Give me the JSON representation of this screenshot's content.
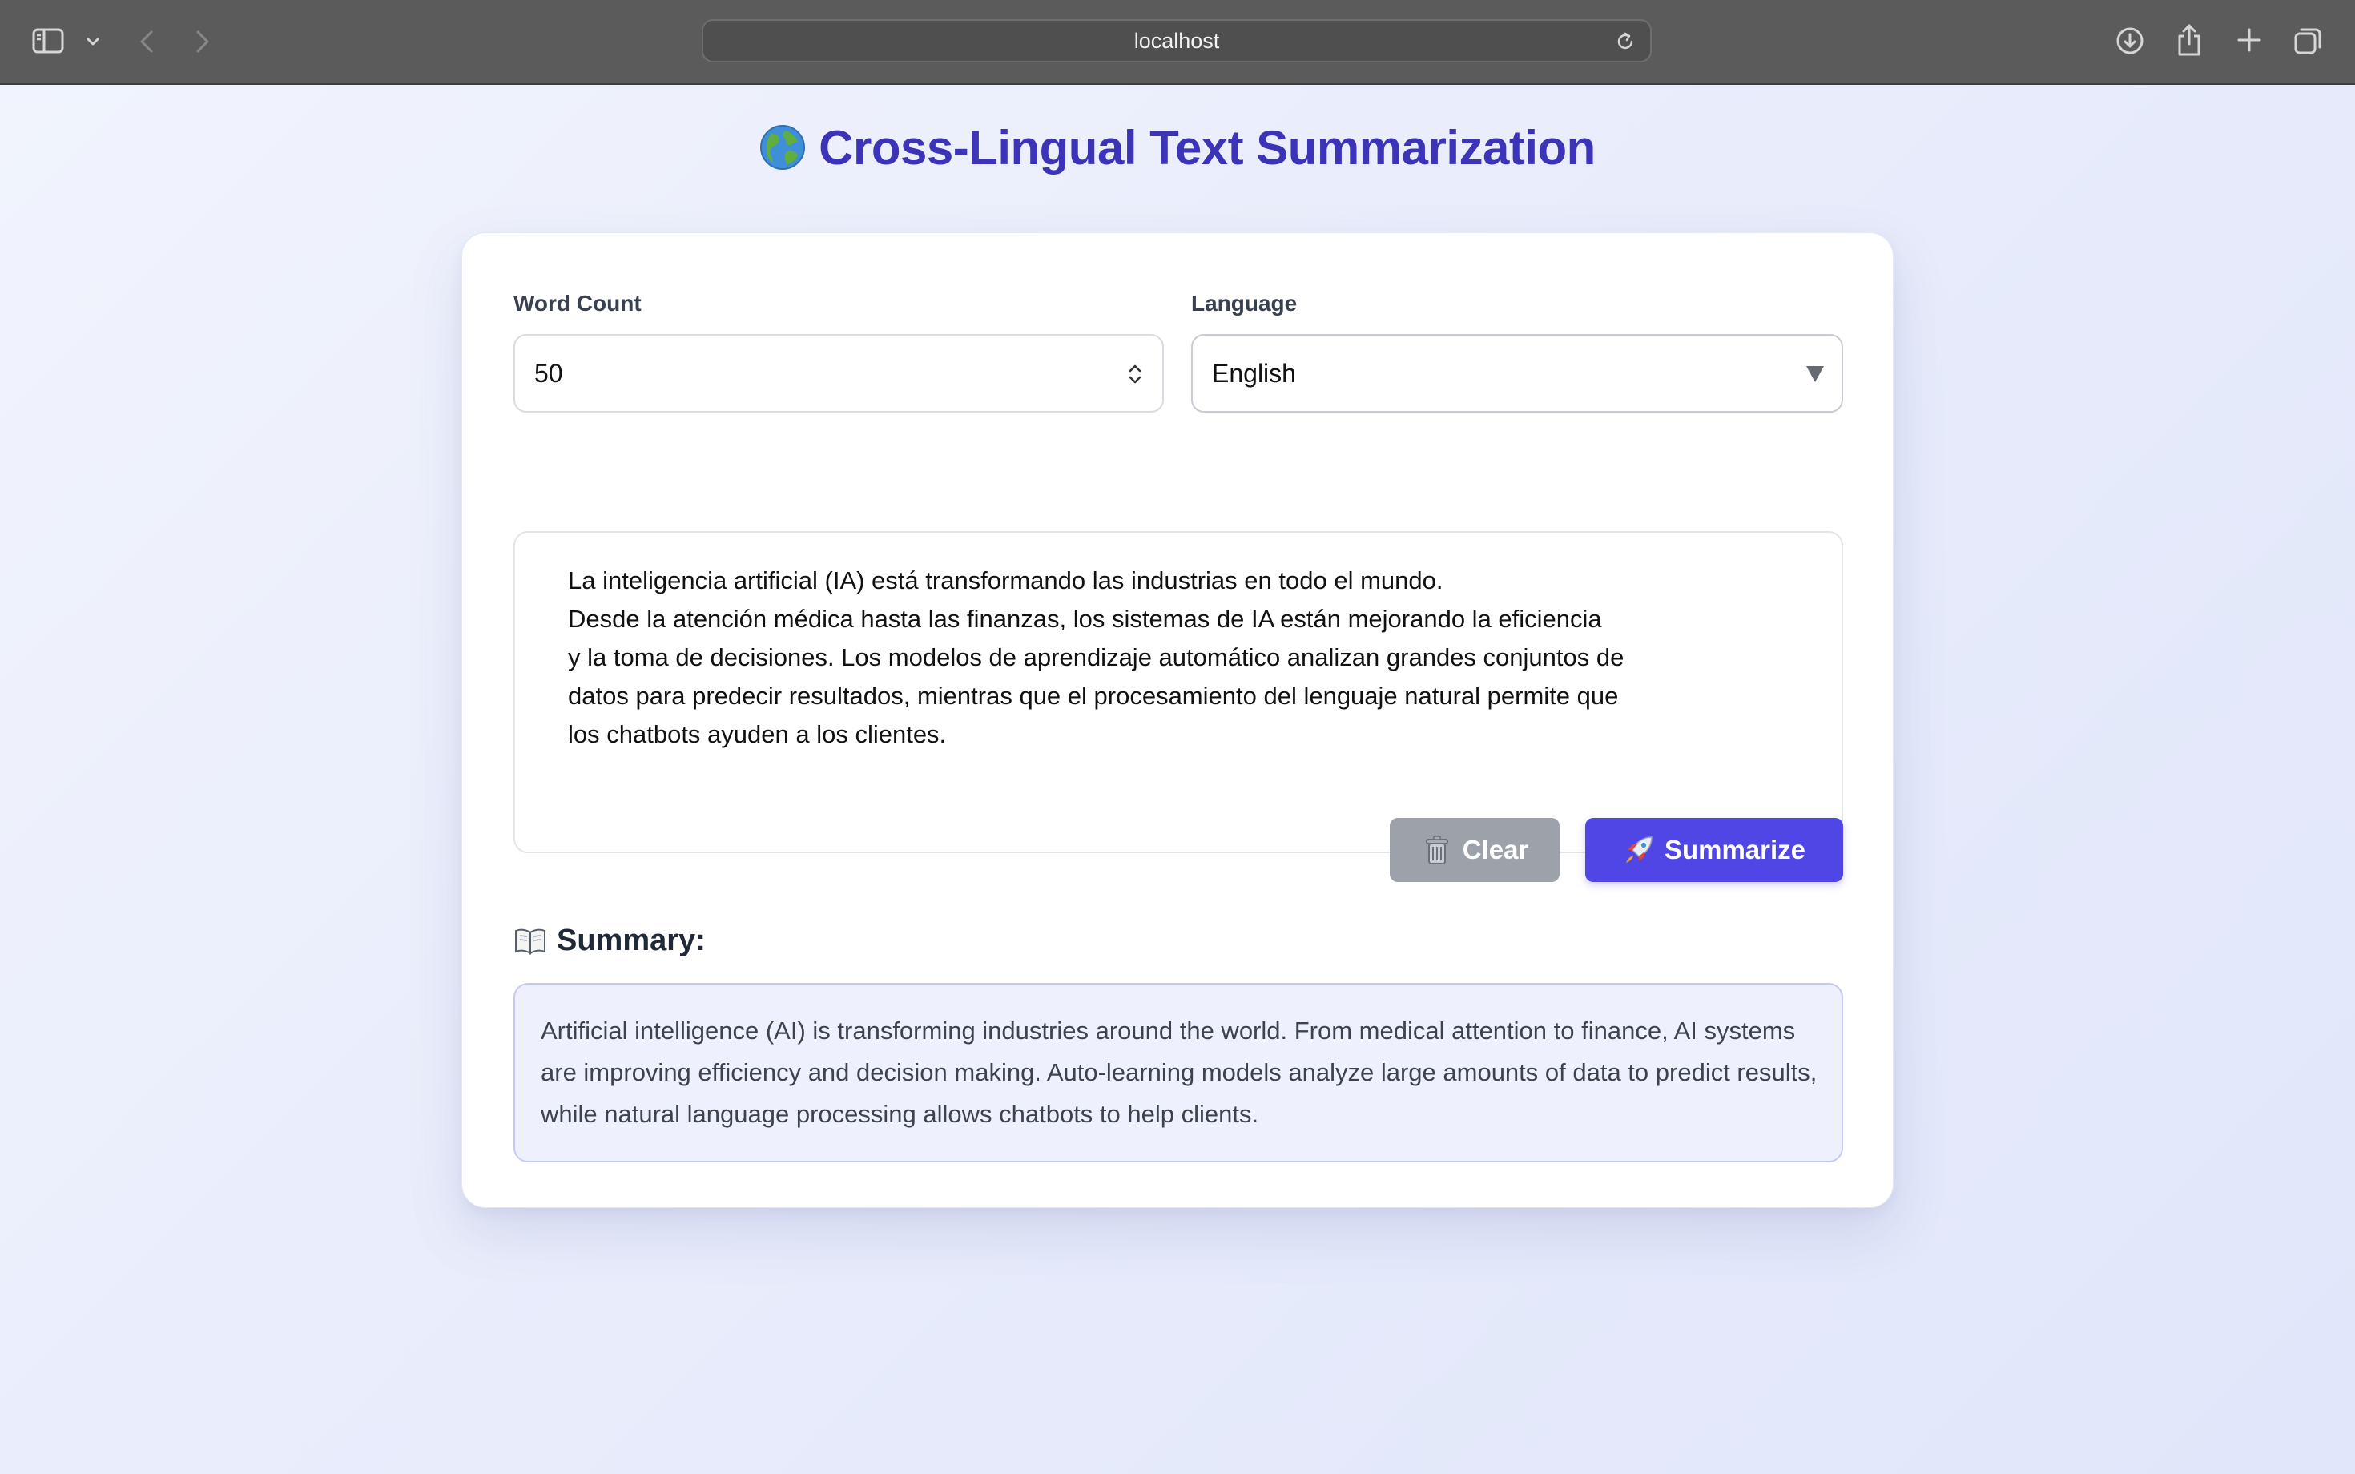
{
  "browser": {
    "url": "localhost"
  },
  "page": {
    "title": "Cross-Lingual Text Summarization",
    "title_icon": "globe-icon"
  },
  "form": {
    "word_count_label": "Word Count",
    "word_count_value": "50",
    "language_label": "Language",
    "language_selected": "English",
    "source_text": "La inteligencia artificial (IA) está transformando las industrias en todo el mundo.\nDesde la atención médica hasta las finanzas, los sistemas de IA están mejorando la eficiencia\ny la toma de decisiones. Los modelos de aprendizaje automático analizan grandes conjuntos de\ndatos para predecir resultados, mientras que el procesamiento del lenguaje natural permite que\nlos chatbots ayuden a los clientes."
  },
  "buttons": {
    "clear_label": "Clear",
    "clear_icon": "trash-icon",
    "summarize_label": "Summarize",
    "summarize_icon": "rocket-icon"
  },
  "summary": {
    "heading": "Summary:",
    "heading_icon": "book-icon",
    "text": "Artificial intelligence (AI) is transforming industries around the world. From medical attention to finance, AI systems are improving efficiency and decision making. Auto-learning models analyze large amounts of data to predict results, while natural language processing allows chatbots to help clients."
  },
  "colors": {
    "accent": "#4f46e5",
    "title": "#3b34b8",
    "clear_button": "#9ca1aa",
    "summary_background": "#eef1fd"
  }
}
